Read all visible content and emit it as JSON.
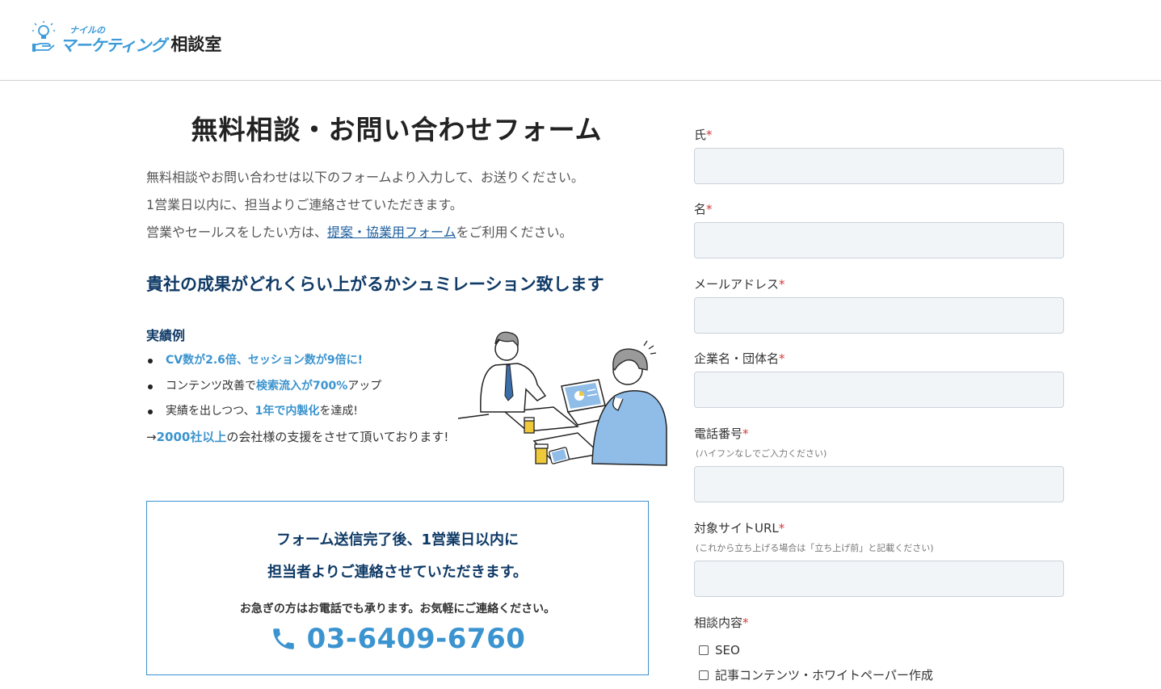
{
  "header": {
    "logo_small": "ナイルの",
    "logo_blue": "マーケティング",
    "logo_black": "相談室"
  },
  "main": {
    "title": "無料相談・お問い合わせフォーム",
    "intro_line1": "無料相談やお問い合わせは以下のフォームより入力して、お送りください。",
    "intro_line2": "1営業日以内に、担当よりご連絡させていただきます。",
    "intro_line3_pre": "営業やセールスをしたい方は、",
    "intro_line3_link": "提案・協業用フォーム",
    "intro_line3_post": "をご利用ください。",
    "sim_heading": "貴社の成果がどれくらい上がるかシュミレーション致します",
    "results_title": "実績例",
    "results": [
      {
        "pre": "",
        "hl": "CV数が2.6倍、セッション数が9倍に!",
        "post": ""
      },
      {
        "pre": "コンテンツ改善で",
        "hl": "検索流入が700%",
        "post": "アップ"
      },
      {
        "pre": "実績を出しつつ、",
        "hl": "1年で内製化",
        "post": "を達成!"
      }
    ],
    "support_pre": "→",
    "support_hl": "2000社以上",
    "support_post": "の会社様の支援をさせて頂いております!"
  },
  "contact_box": {
    "line1": "フォーム送信完了後、1営業日以内に",
    "line2": "担当者よりご連絡させていただきます。",
    "note": "お急ぎの方はお電話でも承ります。お気軽にご連絡ください。",
    "phone": "03-6409-6760"
  },
  "form": {
    "required_mark": "*",
    "last_name_label": "氏",
    "first_name_label": "名",
    "email_label": "メールアドレス",
    "company_label": "企業名・団体名",
    "phone_label": "電話番号",
    "phone_hint": "(ハイフンなしでご入力ください)",
    "url_label": "対象サイトURL",
    "url_hint": "(これから立ち上げる場合は「立ち上げ前」と記載ください)",
    "topic_label": "相談内容",
    "topic_options": [
      "SEO",
      "記事コンテンツ・ホワイトペーパー作成"
    ]
  },
  "colors": {
    "accent": "#3b94cf",
    "navy": "#0f3a66",
    "required": "#d63a3a",
    "input_bg": "#f2f5f8"
  }
}
